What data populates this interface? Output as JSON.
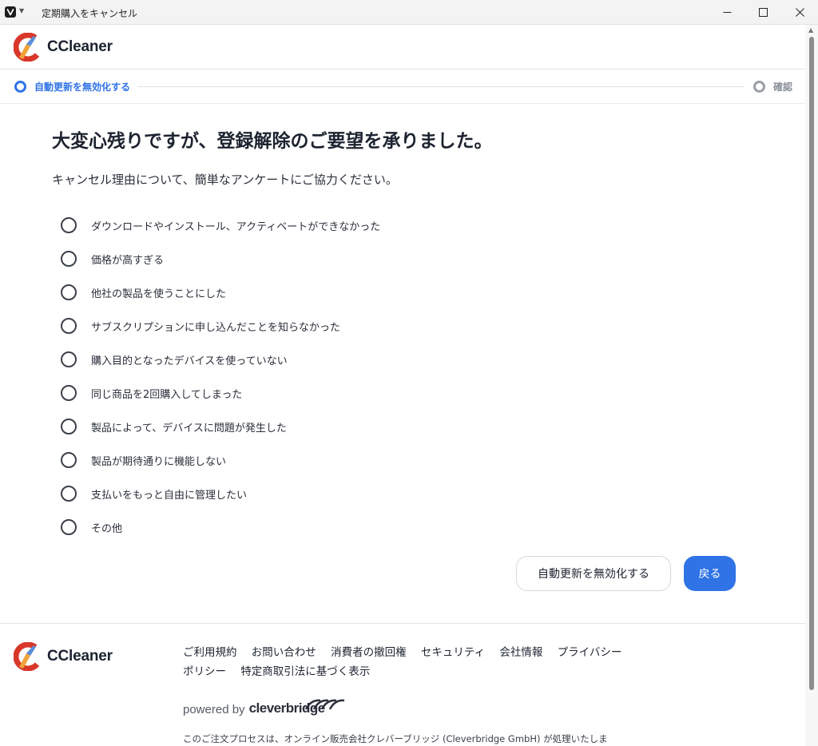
{
  "window": {
    "title": "定期購入をキャンセル"
  },
  "header": {
    "logo_text": "CCleaner"
  },
  "stepper": {
    "step1_label": "自動更新を無効化する",
    "step2_label": "確認",
    "active_color": "#2f73e6",
    "inactive_color": "#9aa0a6"
  },
  "main": {
    "title": "大変心残りですが、登録解除のご要望を承りました。",
    "subtitle": "キャンセル理由について、簡単なアンケートにご協力ください。",
    "options": [
      "ダウンロードやインストール、アクティベートができなかった",
      "価格が高すぎる",
      "他社の製品を使うことにした",
      "サブスクリプションに申し込んだことを知らなかった",
      "購入目的となったデバイスを使っていない",
      "同じ商品を2回購入してしまった",
      "製品によって、デバイスに問題が発生した",
      "製品が期待通りに機能しない",
      "支払いをもっと自由に管理したい",
      "その他"
    ],
    "disable_button_label": "自動更新を無効化する",
    "back_button_label": "戻る",
    "accent_color": "#2f73e6"
  },
  "footer": {
    "logo_text": "CCleaner",
    "links": [
      "ご利用規約",
      "お問い合わせ",
      "消費者の撤回権",
      "セキュリティ",
      "会社情報",
      "プライバシーポリシー",
      "特定商取引法に基づく表示"
    ],
    "powered_by": "powered by",
    "powered_by_brand": "cleverbridge",
    "note": "このご注文プロセスは、オンライン販売会社クレバーブリッジ (Cleverbridge GmbH) が処理いたしま"
  }
}
